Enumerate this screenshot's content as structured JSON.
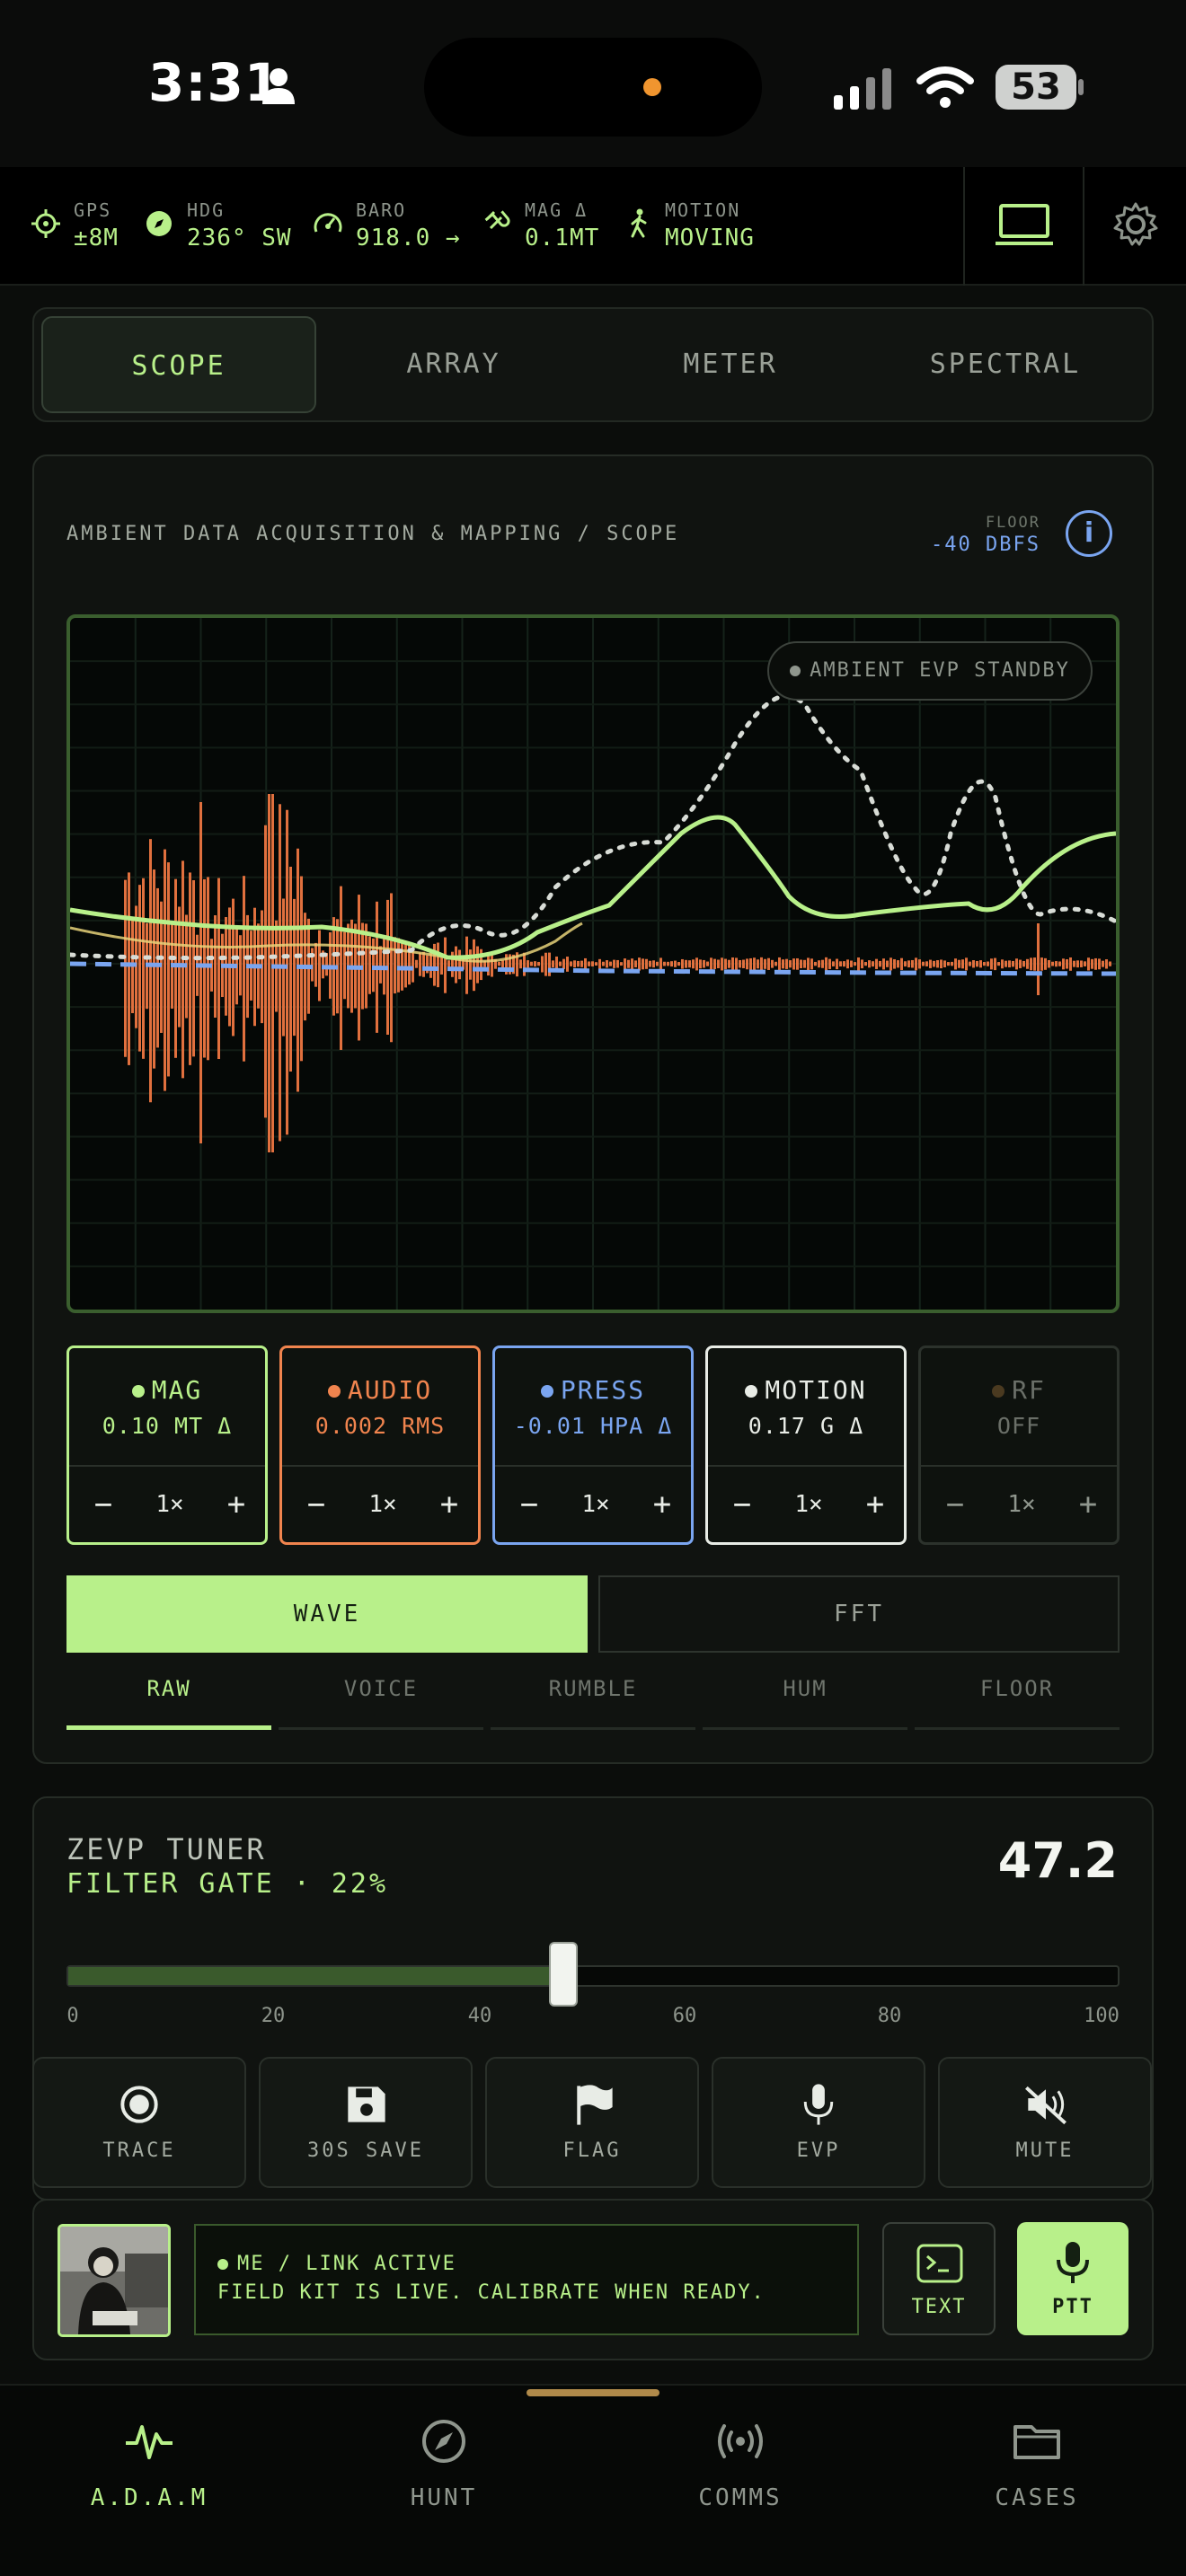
{
  "status_bar": {
    "time": "3:31",
    "battery": "53"
  },
  "sensors": [
    {
      "label": "GPS",
      "value": "±8M"
    },
    {
      "label": "HDG",
      "value": "236° SW"
    },
    {
      "label": "BARO",
      "value": "918.0 →"
    },
    {
      "label": "MAG Δ",
      "value": "0.1MT"
    },
    {
      "label": "MOTION",
      "value": "MOVING"
    }
  ],
  "tabs": [
    {
      "label": "SCOPE",
      "active": true
    },
    {
      "label": "ARRAY",
      "active": false
    },
    {
      "label": "METER",
      "active": false
    },
    {
      "label": "SPECTRAL",
      "active": false
    }
  ],
  "scope": {
    "title": "AMBIENT DATA ACQUISITION & MAPPING / SCOPE",
    "floor_label": "FLOOR",
    "floor_value": "-40 DBFS",
    "evp_status": "AMBIENT EVP STANDBY"
  },
  "channels": [
    {
      "name": "MAG",
      "reading": "0.10 MT Δ",
      "gain": "1×",
      "color": "#b8f08a",
      "border": "#b8f08a",
      "dot": "#b8f08a"
    },
    {
      "name": "AUDIO",
      "reading": "0.002 RMS",
      "gain": "1×",
      "color": "#f0844e",
      "border": "#f0844e",
      "dot": "#f0844e"
    },
    {
      "name": "PRESS",
      "reading": "-0.01 HPA Δ",
      "gain": "1×",
      "color": "#7aa5f0",
      "border": "#7aa5f0",
      "dot": "#7aa5f0"
    },
    {
      "name": "MOTION",
      "reading": "0.17 G Δ",
      "gain": "1×",
      "color": "#e8ece6",
      "border": "#e8ece6",
      "dot": "#e8ece6"
    },
    {
      "name": "RF",
      "reading": "OFF",
      "gain": "1×",
      "color": "#6a6f68",
      "border": "#2c322c",
      "dot": "#4a3a20"
    }
  ],
  "view_modes": {
    "wave": "WAVE",
    "fft": "FFT",
    "active": "WAVE"
  },
  "filters": [
    {
      "label": "RAW",
      "active": true
    },
    {
      "label": "VOICE",
      "active": false
    },
    {
      "label": "RUMBLE",
      "active": false
    },
    {
      "label": "HUM",
      "active": false
    },
    {
      "label": "FLOOR",
      "active": false
    }
  ],
  "tuner": {
    "title": "ZEVP TUNER",
    "subtitle": "FILTER GATE · 22%",
    "value": "47.2",
    "slider_value": 47.2,
    "ticks": [
      "0",
      "20",
      "40",
      "60",
      "80",
      "100"
    ]
  },
  "actions": [
    {
      "label": "TRACE",
      "icon": "record-icon"
    },
    {
      "label": "30S SAVE",
      "icon": "save-icon"
    },
    {
      "label": "FLAG",
      "icon": "flag-icon"
    },
    {
      "label": "EVP",
      "icon": "microphone-icon"
    },
    {
      "label": "MUTE",
      "icon": "speaker-mute-icon"
    }
  ],
  "comms": {
    "status": "ME / LINK ACTIVE",
    "message": "FIELD KIT IS LIVE. CALIBRATE WHEN READY.",
    "text_label": "TEXT",
    "ptt_label": "PTT"
  },
  "bottom_nav": [
    {
      "label": "A.D.A.M",
      "icon": "pulse-icon",
      "active": true
    },
    {
      "label": "HUNT",
      "icon": "compass-icon",
      "active": false
    },
    {
      "label": "COMMS",
      "icon": "broadcast-icon",
      "active": false
    },
    {
      "label": "CASES",
      "icon": "folder-icon",
      "active": false
    }
  ],
  "colors": {
    "accent": "#b8f08a",
    "audio": "#f0844e",
    "pressure": "#7aa5f0",
    "background": "#0b0d0b"
  }
}
